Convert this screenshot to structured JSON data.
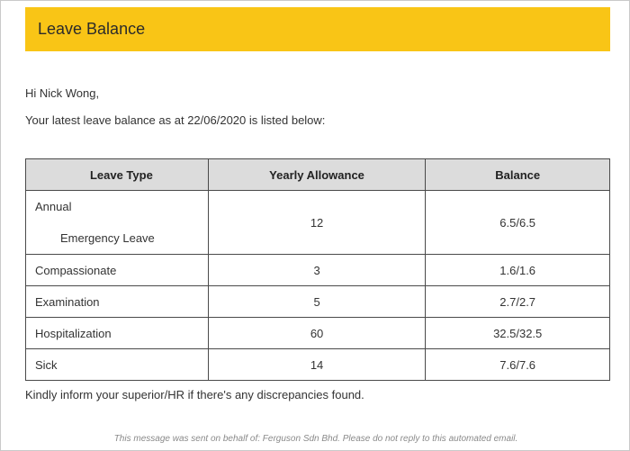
{
  "header": {
    "title": "Leave Balance"
  },
  "greeting": "Hi Nick Wong,",
  "intro": "Your latest leave balance as at 22/06/2020 is listed below:",
  "table": {
    "headers": [
      "Leave Type",
      "Yearly Allowance",
      "Balance"
    ],
    "rows": [
      {
        "type": "Annual",
        "sub": "Emergency Leave",
        "allowance": "12",
        "balance": "6.5/6.5"
      },
      {
        "type": "Compassionate",
        "allowance": "3",
        "balance": "1.6/1.6"
      },
      {
        "type": "Examination",
        "allowance": "5",
        "balance": "2.7/2.7"
      },
      {
        "type": "Hospitalization",
        "allowance": "60",
        "balance": "32.5/32.5"
      },
      {
        "type": "Sick",
        "allowance": "14",
        "balance": "7.6/7.6"
      }
    ]
  },
  "closing": "Kindly inform your superior/HR if there's any discrepancies found.",
  "footer": "This message was sent on behalf of: Ferguson Sdn Bhd. Please do not reply to this automated email.",
  "colors": {
    "banner": "#f9c516",
    "header_row": "#dcdcdc",
    "border": "#4a4a4a"
  }
}
